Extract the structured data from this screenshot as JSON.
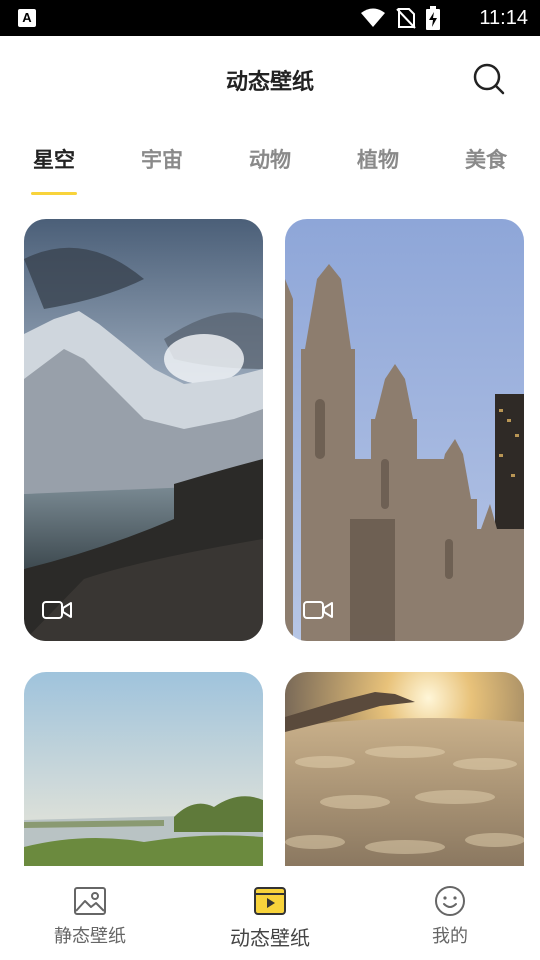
{
  "status_bar": {
    "time": "11:14",
    "app_badge": "A",
    "icons": [
      "wifi-icon",
      "no-sim-icon",
      "battery-charging-icon"
    ]
  },
  "header": {
    "title": "动态壁纸",
    "search_icon": "search-icon"
  },
  "tabs": [
    {
      "label": "星空",
      "active": true
    },
    {
      "label": "宇宙",
      "active": false
    },
    {
      "label": "动物",
      "active": false
    },
    {
      "label": "植物",
      "active": false
    },
    {
      "label": "美食",
      "active": false
    }
  ],
  "accent_color": "#f8d33b",
  "wallpapers": [
    {
      "scene": "mountain lake",
      "video_icon": "video-camera-icon"
    },
    {
      "scene": "gothic church spires",
      "video_icon": "video-camera-icon"
    },
    {
      "scene": "misty lake with trees"
    },
    {
      "scene": "sunset above clouds from airplane wing"
    }
  ],
  "bottom_nav": [
    {
      "label": "静态壁纸",
      "icon": "image-icon",
      "active": false
    },
    {
      "label": "动态壁纸",
      "icon": "video-play-icon",
      "active": true
    },
    {
      "label": "我的",
      "icon": "smile-face-icon",
      "active": false
    }
  ]
}
